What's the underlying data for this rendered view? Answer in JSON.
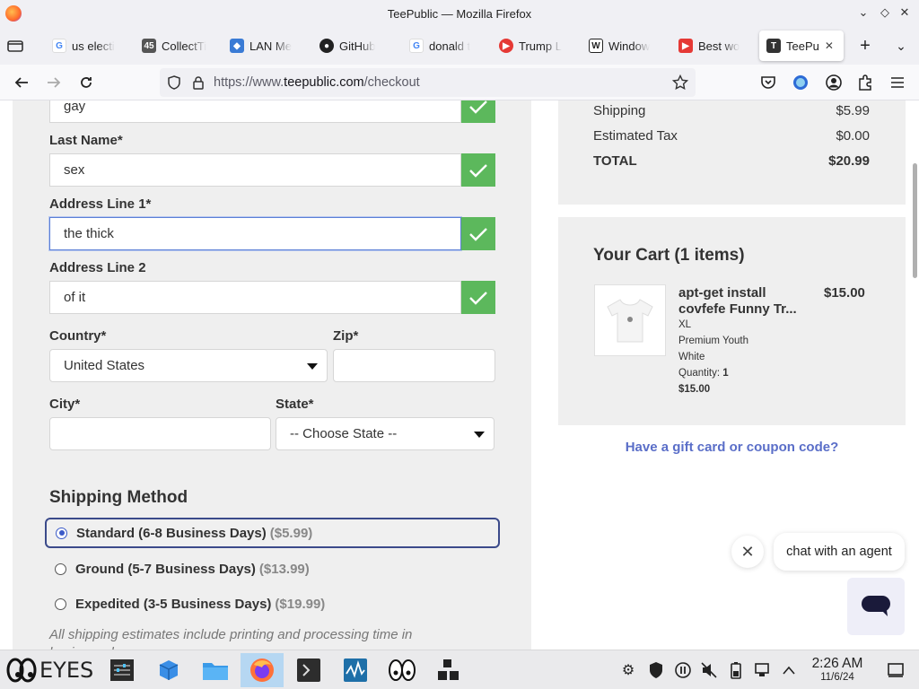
{
  "window": {
    "title": "TeePublic — Mozilla Firefox",
    "minimize_glyph": "⌄",
    "maximize_glyph": "◇",
    "close_glyph": "✕"
  },
  "tabs": [
    {
      "label": "us electi",
      "icon": "google-icon"
    },
    {
      "label": "CollectTi",
      "icon": "collect-icon"
    },
    {
      "label": "LAN Me",
      "icon": "lan-icon"
    },
    {
      "label": "GitHub",
      "icon": "github-icon"
    },
    {
      "label": "donald t",
      "icon": "google-icon"
    },
    {
      "label": "Trump L",
      "icon": "youtube-red-icon"
    },
    {
      "label": "Window",
      "icon": "window-icon"
    },
    {
      "label": "Best wo",
      "icon": "youtube-icon"
    },
    {
      "label": "TeePu",
      "icon": "teepublic-icon",
      "active": true
    }
  ],
  "tab_controls": {
    "new_tab": "+",
    "list_tabs": "⌄"
  },
  "nav": {
    "url_proto": "https://www.",
    "url_domain": "teepublic.com",
    "url_path": "/checkout"
  },
  "form": {
    "first_name_value": "gay",
    "last_name_label": "Last Name*",
    "last_name_value": "sex",
    "address1_label": "Address Line 1*",
    "address1_value": "the thick",
    "address2_label": "Address Line 2",
    "address2_value": "of it",
    "country_label": "Country*",
    "country_value": "United States",
    "zip_label": "Zip*",
    "zip_value": "",
    "city_label": "City*",
    "city_value": "",
    "state_label": "State*",
    "state_value": "-- Choose State --"
  },
  "shipping": {
    "title": "Shipping Method",
    "options": [
      {
        "name": "Standard (6-8 Business Days)",
        "price": "($5.99)",
        "selected": true
      },
      {
        "name": "Ground (5-7 Business Days)",
        "price": "($13.99)",
        "selected": false
      },
      {
        "name": "Expedited (3-5 Business Days)",
        "price": "($19.99)",
        "selected": false
      }
    ],
    "note": "All shipping estimates include printing and processing time in business days."
  },
  "summary": {
    "shipping_label": "Shipping",
    "shipping_value": "$5.99",
    "tax_label": "Estimated Tax",
    "tax_value": "$0.00",
    "total_label": "TOTAL",
    "total_value": "$20.99"
  },
  "cart": {
    "title": "Your Cart (1 items)",
    "item_name": "apt-get install covfefe Funny Tr...",
    "item_price": "$15.00",
    "size": "XL",
    "style": "Premium Youth",
    "color": "White",
    "quantity_label": "Quantity:",
    "quantity_value": "1",
    "line_total": "$15.00"
  },
  "gift_link": "Have a gift card or coupon code?",
  "chat": {
    "bubble_text": "chat with an agent",
    "close_glyph": "✕"
  },
  "taskbar": {
    "app_label": "EYES",
    "time": "2:26 AM",
    "date": "11/6/24"
  },
  "colors": {
    "check_green": "#5cb85c",
    "link_blue": "#5a6ec8",
    "focus_blue": "#5b7fd6",
    "selected_border": "#3b4a8a"
  }
}
